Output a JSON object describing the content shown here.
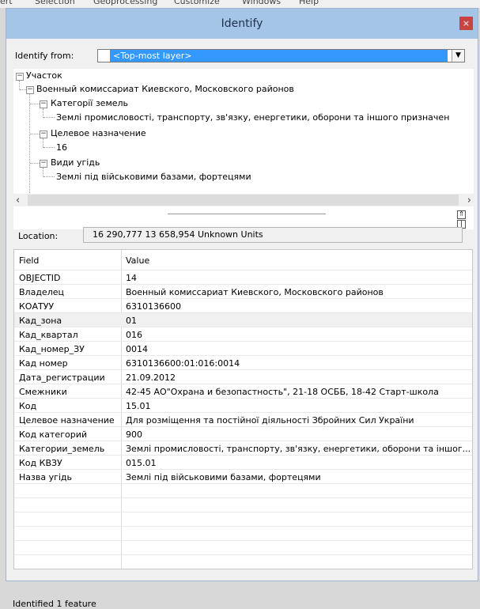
{
  "menubar": {
    "items": [
      "ert",
      "Selection",
      "Geoprocessing",
      "Customize",
      "Windows",
      "Help"
    ]
  },
  "window": {
    "title": "Identify",
    "close_glyph": "×"
  },
  "identify_from": {
    "label": "Identify from:",
    "value": "<Top-most layer>"
  },
  "tree": {
    "root": "Участок",
    "feature": "Военный комиссариат Киевского, Московского районов",
    "groups": [
      {
        "label": "Категорії земель",
        "value": "Землі промисловості, транспорту, зв'язку, енергетики, оборони та іншого призначен"
      },
      {
        "label": "Целевое назначение",
        "value": "16"
      },
      {
        "label": "Види угідь",
        "value": "Землі під військовими базами, фортецями"
      }
    ]
  },
  "location": {
    "label": "Location:",
    "value": "16 290,777  13 658,954 Unknown Units"
  },
  "table": {
    "headers": {
      "field": "Field",
      "value": "Value"
    },
    "rows": [
      {
        "field": "OBJECTID",
        "value": "14"
      },
      {
        "field": "Владелец",
        "value": "Военный комиссариат Киевского, Московского районов"
      },
      {
        "field": "КОАТУУ",
        "value": "6310136600"
      },
      {
        "field": "Кад_зона",
        "value": "01"
      },
      {
        "field": "Кад_квартал",
        "value": "016"
      },
      {
        "field": "Кад_номер_ЗУ",
        "value": "0014"
      },
      {
        "field": "Кад номер",
        "value": "6310136600:01:016:0014"
      },
      {
        "field": "Дата_регистрации",
        "value": "21.09.2012"
      },
      {
        "field": "Смежники",
        "value": "42-45 АО\"Охрана и безопастность\", 21-18 ОСББ, 18-42 Старт-школа"
      },
      {
        "field": "Код",
        "value": "15.01"
      },
      {
        "field": "Целевое назначение",
        "value": "Для розміщення та постійної діяльності Збройних Сил України"
      },
      {
        "field": "Код категорий",
        "value": "900"
      },
      {
        "field": "Категории_земель",
        "value": "Землі промисловості, транспорту, зв'язку, енергетики, оборони та іншог..."
      },
      {
        "field": "Код КВЗУ",
        "value": "015.01"
      },
      {
        "field": "Назва угідь",
        "value": "Землі під військовими базами, фортецями"
      }
    ]
  },
  "status": {
    "text": "Identified 1 feature"
  },
  "colors": {
    "titlebar": "#a5c5e6",
    "close": "#c74440",
    "selection": "#3399ff"
  }
}
